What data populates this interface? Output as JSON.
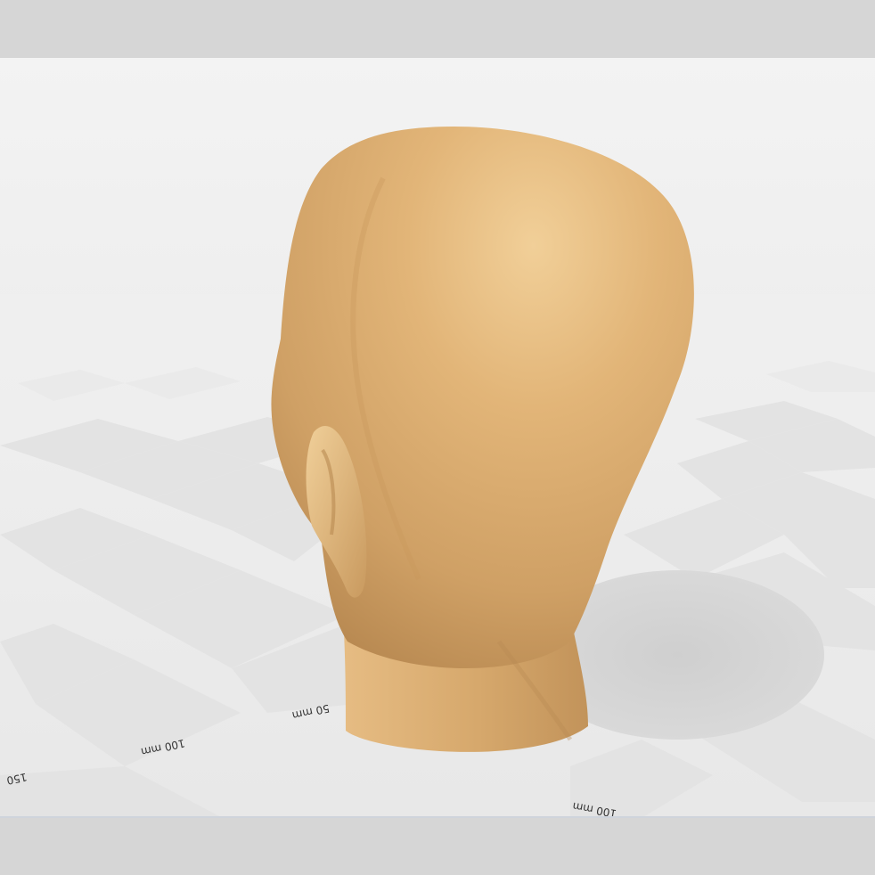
{
  "viewport": {
    "ruler_labels": {
      "left_50": "50 mm",
      "left_100": "100 mm",
      "left_150": "150",
      "front_100": "100 mm"
    },
    "model": {
      "name": "head-model",
      "color": "#d6a86c"
    },
    "colors": {
      "floor_light": "#f2f2f2",
      "floor_dark": "#e2e2e2",
      "shadow": "#d2d2d2",
      "chrome": "#d6d6d6"
    }
  }
}
